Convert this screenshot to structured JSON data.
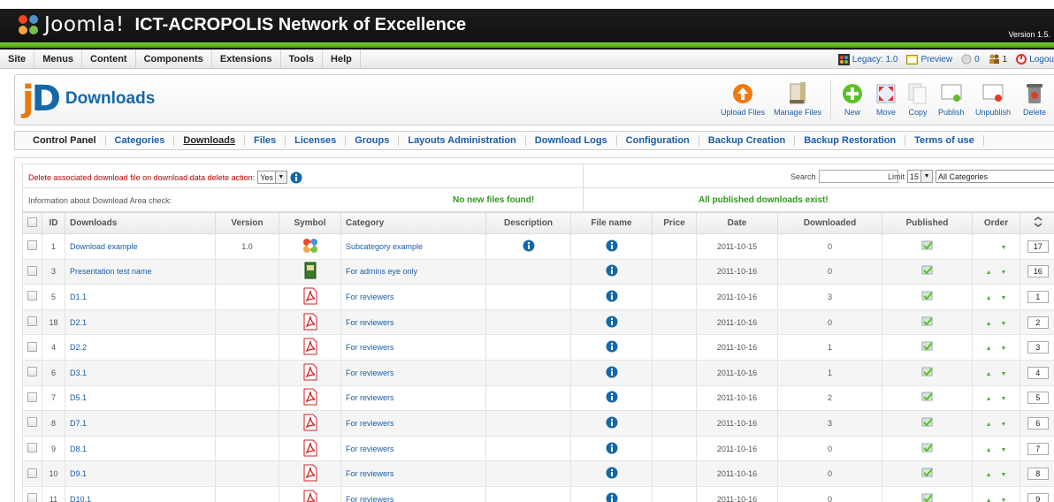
{
  "header": {
    "brand": "Joomla!",
    "site_title": "ICT-ACROPOLIS Network of Excellence",
    "version": "Version 1.5."
  },
  "menu": {
    "items": [
      "Site",
      "Menus",
      "Content",
      "Components",
      "Extensions",
      "Tools",
      "Help"
    ],
    "legacy": "Legacy: 1.0",
    "preview": "Preview",
    "messages": "0",
    "users": "1",
    "logout": "Logou"
  },
  "toolbar": {
    "title": "Downloads",
    "buttons": {
      "upload": "Upload Files",
      "manage": "Manage Files",
      "new": "New",
      "move": "Move",
      "copy": "Copy",
      "publish": "Publish",
      "unpublish": "Unpublish",
      "delete": "Delete"
    }
  },
  "subnav": [
    "Control Panel",
    "Categories",
    "Downloads",
    "Files",
    "Licenses",
    "Groups",
    "Layouts Administration",
    "Download Logs",
    "Configuration",
    "Backup Creation",
    "Backup Restoration",
    "Terms of use"
  ],
  "filters": {
    "delete_label": "Delete associated download file on download data delete action:",
    "delete_value": "Yes",
    "search_label": "Search",
    "search_value": "",
    "limit_label": "Limit",
    "limit_value": "15",
    "category_value": "All Categories"
  },
  "info": {
    "label": "Information about Download Area check:",
    "new_files": "No new files found!",
    "published": "All published downloads exist!"
  },
  "table": {
    "columns": [
      "ID",
      "Downloads",
      "Version",
      "Symbol",
      "Category",
      "Description",
      "File name",
      "Price",
      "Date",
      "Downloaded",
      "Published",
      "Order"
    ],
    "rows": [
      {
        "id": "1",
        "name": "Download example",
        "version": "1.0",
        "symbol": "joomla-icon",
        "category": "Subcategory example",
        "description": true,
        "date": "2011-10-15",
        "downloaded": "0",
        "order": "17",
        "up": false
      },
      {
        "id": "3",
        "name": "Presentation test name",
        "version": "",
        "symbol": "presentation-icon",
        "category": "For admins eye only",
        "description": false,
        "date": "2011-10-16",
        "downloaded": "0",
        "order": "16",
        "up": true
      },
      {
        "id": "5",
        "name": "D1.1",
        "version": "",
        "symbol": "pdf-icon",
        "category": "For reviewers",
        "description": false,
        "date": "2011-10-16",
        "downloaded": "3",
        "order": "1",
        "up": true
      },
      {
        "id": "18",
        "name": "D2.1",
        "version": "",
        "symbol": "pdf-icon",
        "category": "For reviewers",
        "description": false,
        "date": "2011-10-16",
        "downloaded": "0",
        "order": "2",
        "up": true
      },
      {
        "id": "4",
        "name": "D2.2",
        "version": "",
        "symbol": "pdf-icon",
        "category": "For reviewers",
        "description": false,
        "date": "2011-10-16",
        "downloaded": "1",
        "order": "3",
        "up": true
      },
      {
        "id": "6",
        "name": "D3.1",
        "version": "",
        "symbol": "pdf-icon",
        "category": "For reviewers",
        "description": false,
        "date": "2011-10-16",
        "downloaded": "1",
        "order": "4",
        "up": true
      },
      {
        "id": "7",
        "name": "D5.1",
        "version": "",
        "symbol": "pdf-icon",
        "category": "For reviewers",
        "description": false,
        "date": "2011-10-16",
        "downloaded": "2",
        "order": "5",
        "up": true
      },
      {
        "id": "8",
        "name": "D7.1",
        "version": "",
        "symbol": "pdf-icon",
        "category": "For reviewers",
        "description": false,
        "date": "2011-10-16",
        "downloaded": "3",
        "order": "6",
        "up": true
      },
      {
        "id": "9",
        "name": "D8.1",
        "version": "",
        "symbol": "pdf-icon",
        "category": "For reviewers",
        "description": false,
        "date": "2011-10-16",
        "downloaded": "0",
        "order": "7",
        "up": true
      },
      {
        "id": "10",
        "name": "D9.1",
        "version": "",
        "symbol": "pdf-icon",
        "category": "For reviewers",
        "description": false,
        "date": "2011-10-16",
        "downloaded": "0",
        "order": "8",
        "up": true
      },
      {
        "id": "11",
        "name": "D10.1",
        "version": "",
        "symbol": "pdf-icon",
        "category": "For reviewers",
        "description": false,
        "date": "2011-10-16",
        "downloaded": "0",
        "order": "9",
        "up": true
      }
    ]
  },
  "colors": {
    "link": "#1a5ea8",
    "header_bg": "#111111",
    "accent_green": "#4a9e12",
    "brand_orange": "#e47b12",
    "info_blue": "#1467a8"
  }
}
